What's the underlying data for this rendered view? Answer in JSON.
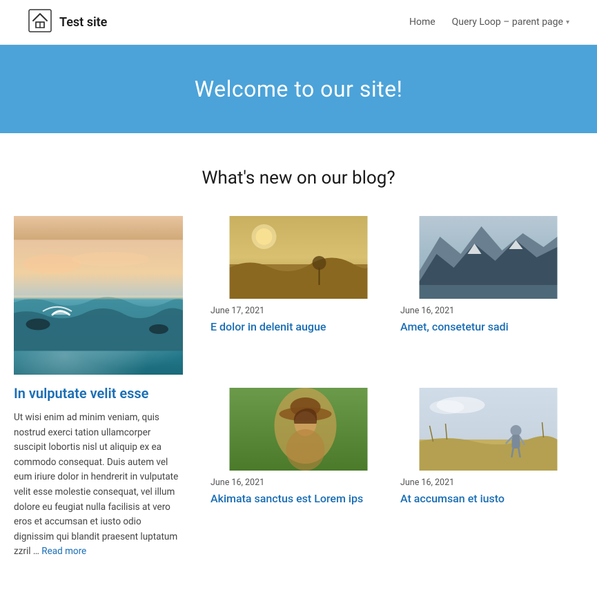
{
  "header": {
    "logo_text": "Test site",
    "nav": {
      "home_label": "Home",
      "query_loop_label": "Query Loop – parent page",
      "dropdown_arrow": "▾"
    }
  },
  "hero": {
    "title": "Welcome to our site!"
  },
  "main": {
    "section_title": "What's new on our blog?",
    "posts": {
      "featured": {
        "title": "In vulputate velit esse",
        "excerpt": "Ut wisi enim ad minim veniam, quis nostrud exerci tation ullamcorper suscipit lobortis nisl ut aliquip ex ea commodo consequat. Duis autem vel eum iriure dolor in hendrerit in vulputate velit esse molestie consequat, vel illum dolore eu feugiat nulla facilisis at vero eros et accumsan et iusto odio dignissim qui blandit praesent luptatum zzril …",
        "read_more": "Read more"
      },
      "small": [
        {
          "date": "June 17, 2021",
          "title": "E dolor in delenit augue"
        },
        {
          "date": "June 16, 2021",
          "title": "Amet, consetetur sadi"
        },
        {
          "date": "June 16, 2021",
          "title": "Akimata sanctus est Lorem ips"
        },
        {
          "date": "June 16, 2021",
          "title": "At accumsan et iusto"
        }
      ]
    }
  }
}
